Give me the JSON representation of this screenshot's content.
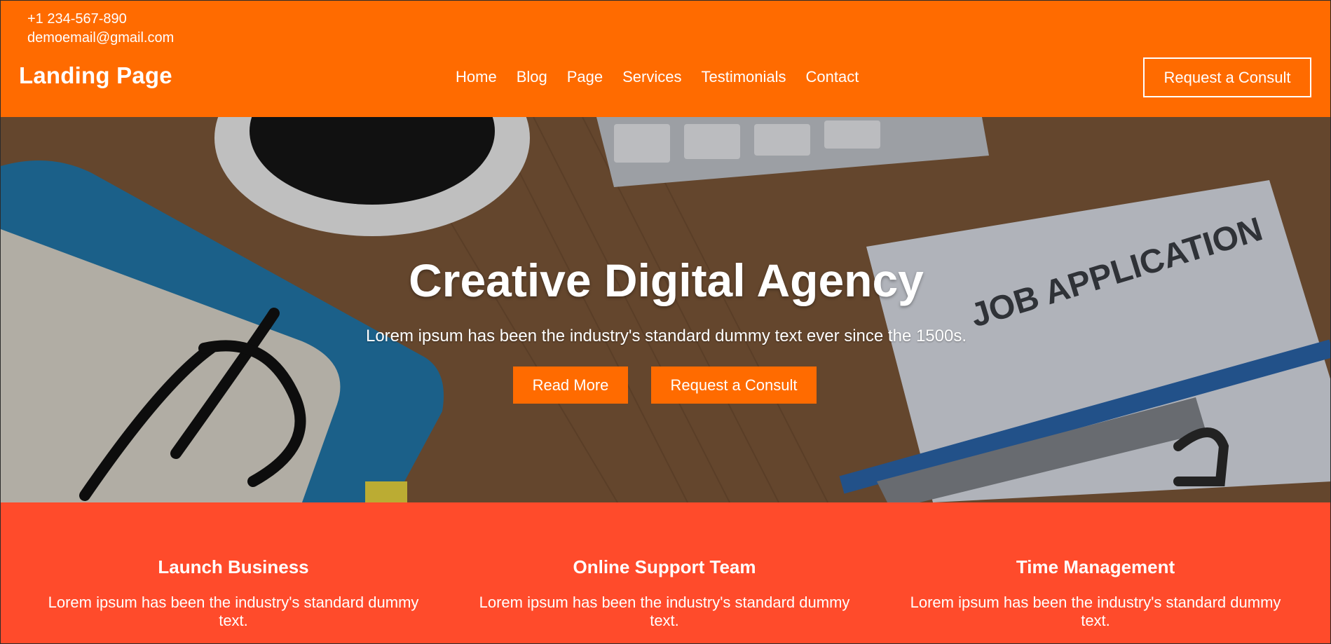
{
  "header": {
    "phone": "+1 234-567-890",
    "email": "demoemail@gmail.com",
    "brand": "Landing Page",
    "nav": [
      {
        "label": "Home"
      },
      {
        "label": "Blog"
      },
      {
        "label": "Page"
      },
      {
        "label": "Services"
      },
      {
        "label": "Testimonials"
      },
      {
        "label": "Contact"
      }
    ],
    "cta_label": "Request a Consult"
  },
  "hero": {
    "title": "Creative Digital Agency",
    "subtitle": "Lorem ipsum has been the industry's standard dummy text ever since the 1500s.",
    "read_more_label": "Read More",
    "consult_label": "Request a Consult",
    "background_paper_text": "JOB APPLICATION"
  },
  "features": [
    {
      "title": "Launch Business",
      "text": "Lorem ipsum has been the industry's standard dummy text."
    },
    {
      "title": "Online Support Team",
      "text": "Lorem ipsum has been the industry's standard dummy text."
    },
    {
      "title": "Time Management",
      "text": "Lorem ipsum has been the industry's standard dummy text."
    }
  ],
  "colors": {
    "header_bg": "#ff6b00",
    "button_bg": "#ff6b00",
    "features_bg": "#ff4b2b",
    "text": "#ffffff"
  }
}
